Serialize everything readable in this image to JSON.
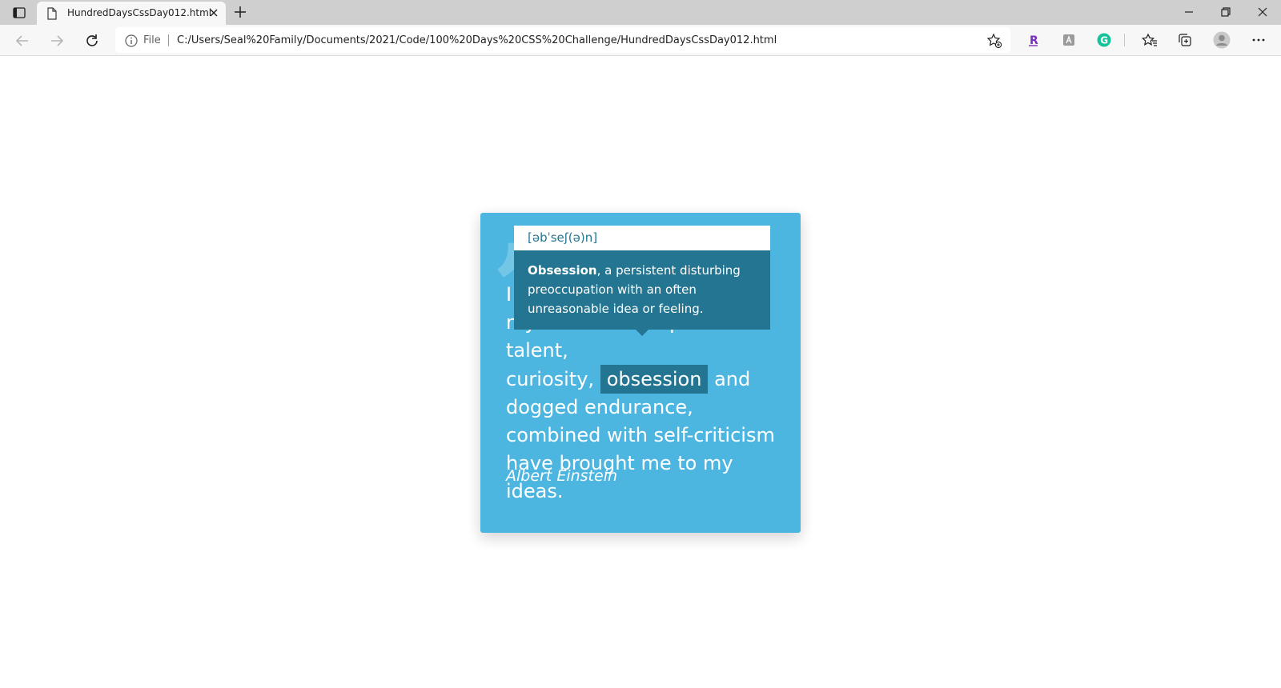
{
  "browser": {
    "tab": {
      "title": "HundredDaysCssDay012.html"
    },
    "address": {
      "scheme_label": "File",
      "url": "C:/Users/Seal%20Family/Documents/2021/Code/100%20Days%20CSS%20Challenge/HundredDaysCssDay012.html"
    },
    "extensions": [
      {
        "icon": "r-extension-icon",
        "glyph": "R",
        "color": "#7b2fbf"
      },
      {
        "icon": "puzzle-extension-icon",
        "glyph": "⚲",
        "color": "#8a8a8a"
      },
      {
        "icon": "grammarly-icon",
        "glyph": "G",
        "color": "#15c39a"
      }
    ]
  },
  "quote": {
    "mark": "”",
    "line_start": "I",
    "line_hidden": "myself have no special talent,",
    "before": "curiosity,",
    "highlight": "obsession",
    "after": "and dogged endurance, combined with self-criticism have brought me to my ideas.",
    "author": "Albert Einstein"
  },
  "tooltip": {
    "pronunciation": "[əbˈseʃ(ə)n]",
    "term": "Obsession",
    "definition": ", a persistent disturbing preoccupation with an often unreasonable idea or feeling."
  },
  "colors": {
    "card": "#4db6e0",
    "accent": "#237591",
    "text_on_card": "#ffffff"
  }
}
